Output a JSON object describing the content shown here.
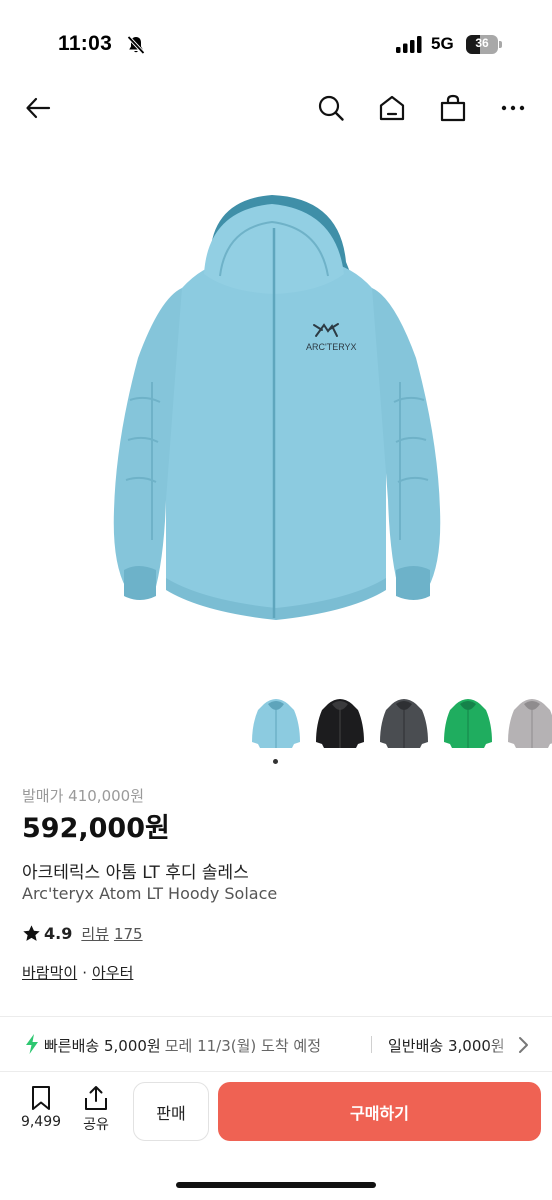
{
  "status_bar": {
    "time": "11:03",
    "network": "5G",
    "battery_level": "36"
  },
  "nav": {
    "icons": [
      "back-arrow-icon",
      "search-icon",
      "home-icon",
      "shopping-bag-icon",
      "more-icon"
    ]
  },
  "product": {
    "image": "jacket-hero",
    "thumbnails": [
      {
        "color": "#8ccbe0",
        "name": "thumbnail-solace"
      },
      {
        "color": "#1c1c1e",
        "name": "thumbnail-black"
      },
      {
        "color": "#4a4d51",
        "name": "thumbnail-graphite"
      },
      {
        "color": "#1fad5f",
        "name": "thumbnail-green"
      },
      {
        "color": "#b5b2b4",
        "name": "thumbnail-grey"
      }
    ],
    "release_price": "발매가 410,000원",
    "price": "592,000원",
    "name_ko": "아크테릭스 아톰 LT 후디 솔레스",
    "name_en": "Arc'teryx Atom LT Hoody Solace",
    "rating": "4.9",
    "review_label": "리뷰",
    "review_count": "175",
    "categories": [
      "바람막이",
      "아우터"
    ],
    "category_separator": "·"
  },
  "shipping": {
    "fast_label": "빠른배송 5,000원",
    "fast_eta": "모레 11/3(월) 도착 예정",
    "normal_label": "일반배송 3,000원"
  },
  "bottom_bar": {
    "wishlist_count": "9,499",
    "share_label": "공유",
    "sell_label": "판매",
    "buy_label": "구매하기"
  },
  "colors": {
    "accent": "#ef6253",
    "bolt": "#2ec771",
    "jacket": "#8ccbe0"
  }
}
